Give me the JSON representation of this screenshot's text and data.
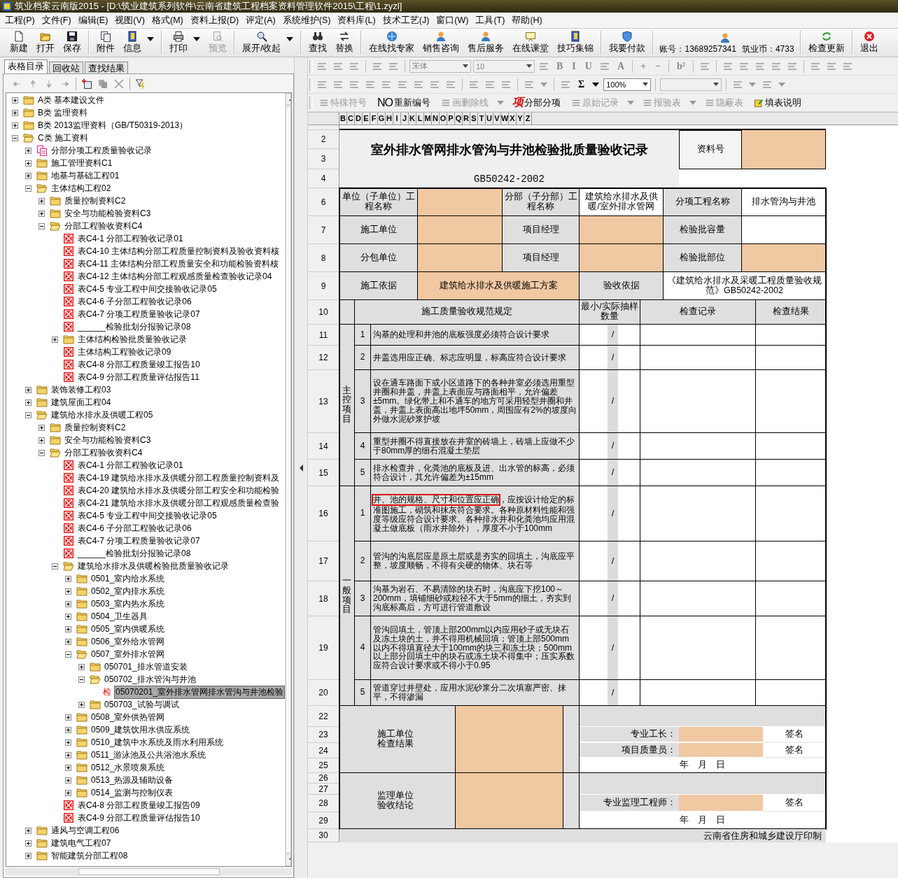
{
  "window": {
    "title": "筑业档案云南版2015 - [D:\\筑业建筑系列软件\\云南省建筑工程档案资料管理软件2015\\工程\\1.zyzl]"
  },
  "menu": [
    "工程(P)",
    "文件(F)",
    "编辑(E)",
    "视图(V)",
    "格式(M)",
    "资料上报(D)",
    "评定(A)",
    "系统维护(S)",
    "资料库(L)",
    "技术工艺(J)",
    "窗口(W)",
    "工具(T)",
    "帮助(H)"
  ],
  "toolbar": [
    {
      "kind": "button",
      "label": "新建",
      "disabled": false
    },
    {
      "kind": "button",
      "label": "打开",
      "disabled": false
    },
    {
      "kind": "button",
      "label": "保存",
      "disabled": false
    },
    {
      "kind": "separator"
    },
    {
      "kind": "button",
      "label": "附件",
      "disabled": false
    },
    {
      "kind": "button",
      "label": "信息",
      "disabled": false,
      "dropdown": true
    },
    {
      "kind": "separator"
    },
    {
      "kind": "button",
      "label": "打印",
      "disabled": false,
      "dropdown": true
    },
    {
      "kind": "button",
      "label": "预览",
      "disabled": true
    },
    {
      "kind": "separator"
    },
    {
      "kind": "button",
      "label": "展开/收起",
      "disabled": false,
      "dropdown": true
    },
    {
      "kind": "separator"
    },
    {
      "kind": "button",
      "label": "查找",
      "disabled": false
    },
    {
      "kind": "button",
      "label": "替换",
      "disabled": false
    },
    {
      "kind": "separator"
    },
    {
      "kind": "button",
      "label": "在线找专家",
      "disabled": false
    },
    {
      "kind": "button",
      "label": "销售咨询",
      "disabled": false
    },
    {
      "kind": "button",
      "label": "售后服务",
      "disabled": false
    },
    {
      "kind": "button",
      "label": "在线课堂",
      "disabled": false
    },
    {
      "kind": "button",
      "label": "技巧集锦",
      "disabled": false
    },
    {
      "kind": "separator"
    },
    {
      "kind": "button",
      "label": "我要付款",
      "disabled": false
    },
    {
      "kind": "separator"
    },
    {
      "kind": "account",
      "account": "账号：13689257341",
      "coins": "筑业币：4733"
    },
    {
      "kind": "separator"
    },
    {
      "kind": "button",
      "label": "检查更新",
      "disabled": false
    },
    {
      "kind": "separator"
    },
    {
      "kind": "button",
      "label": "退出",
      "disabled": false
    }
  ],
  "left_tabs": [
    {
      "label": "表格目录",
      "selected": true
    },
    {
      "label": "回收站",
      "selected": false
    },
    {
      "label": "查找结果",
      "selected": false
    }
  ],
  "tree": [
    {
      "label": "A类 基本建设文件",
      "kind": "folder",
      "expanded": false,
      "selected": false
    },
    {
      "label": "B类 监理资料",
      "kind": "folder",
      "expanded": false,
      "selected": false
    },
    {
      "label": "B类 2013监理资料（GB/T50319-2013）",
      "kind": "folder",
      "expanded": false,
      "selected": false
    },
    {
      "label": "C类 施工资料",
      "kind": "folder",
      "expanded": true,
      "selected": false,
      "children": [
        {
          "label": "分部分项工程质量验收记录",
          "kind": "doc",
          "expanded": false,
          "selected": false
        },
        {
          "label": "施工管理资料C1",
          "kind": "folder",
          "expanded": false,
          "selected": false
        },
        {
          "label": "地基与基础工程01",
          "kind": "folder",
          "expanded": false,
          "selected": false
        },
        {
          "label": "主体结构工程02",
          "kind": "folder",
          "expanded": true,
          "selected": false,
          "children": [
            {
              "label": "质量控制资料C2",
              "kind": "folder",
              "expanded": false,
              "selected": false
            },
            {
              "label": "安全与功能检验资料C3",
              "kind": "folder",
              "expanded": false,
              "selected": false
            },
            {
              "label": "分部工程验收资料C4",
              "kind": "folder",
              "expanded": true,
              "selected": false,
              "children": [
                {
                  "label": "表C4-1 分部工程验收记录01",
                  "kind": "form",
                  "selected": false
                },
                {
                  "label": "表C4-10 主体结构分部工程质量控制资料及验收资料核",
                  "kind": "form",
                  "selected": false
                },
                {
                  "label": "表C4-11 主体结构分部工程质量安全和功能检验资料核",
                  "kind": "form",
                  "selected": false
                },
                {
                  "label": "表C4-12 主体结构分部工程观感质量检查验收记录04",
                  "kind": "form",
                  "selected": false
                },
                {
                  "label": "表C4-5 专业工程中间交接验收记录05",
                  "kind": "form",
                  "selected": false
                },
                {
                  "label": "表C4-6 子分部工程验收记录06",
                  "kind": "form",
                  "selected": false
                },
                {
                  "label": "表C4-7 分项工程质量验收记录07",
                  "kind": "form",
                  "selected": false
                },
                {
                  "label": "______检验批划分报验记录08",
                  "kind": "form",
                  "selected": false
                },
                {
                  "label": "主体结构检验批质量验收记录",
                  "kind": "folder",
                  "expanded": false,
                  "selected": false
                },
                {
                  "label": "主体结构工程验收记录09",
                  "kind": "form",
                  "selected": false
                },
                {
                  "label": "表C4-8 分部工程质量竣工报告10",
                  "kind": "form",
                  "selected": false
                },
                {
                  "label": "表C4-9 分部工程质量评估报告11",
                  "kind": "form",
                  "selected": false
                }
              ]
            }
          ]
        },
        {
          "label": "装饰装修工程03",
          "kind": "folder",
          "expanded": false,
          "selected": false
        },
        {
          "label": "建筑屋面工程04",
          "kind": "folder",
          "expanded": false,
          "selected": false
        },
        {
          "label": "建筑给水排水及供暖工程05",
          "kind": "folder",
          "expanded": true,
          "selected": false,
          "children": [
            {
              "label": "质量控制资料C2",
              "kind": "folder",
              "expanded": false,
              "selected": false
            },
            {
              "label": "安全与功能检验资料C3",
              "kind": "folder",
              "expanded": false,
              "selected": false
            },
            {
              "label": "分部工程验收资料C4",
              "kind": "folder",
              "expanded": true,
              "selected": false,
              "children": [
                {
                  "label": "表C4-1 分部工程验收记录01",
                  "kind": "form",
                  "selected": false
                },
                {
                  "label": "表C4-19 建筑给水排水及供暖分部工程质量控制资料及",
                  "kind": "form",
                  "selected": false
                },
                {
                  "label": "表C4-20 建筑给水排水及供暖分部工程安全和功能检验",
                  "kind": "form",
                  "selected": false
                },
                {
                  "label": "表C4-21 建筑给水排水及供暖分部工程观感质量检查验",
                  "kind": "form",
                  "selected": false
                },
                {
                  "label": "表C4-5 专业工程中间交接验收记录05",
                  "kind": "form",
                  "selected": false
                },
                {
                  "label": "表C4-6 子分部工程验收记录06",
                  "kind": "form",
                  "selected": false
                },
                {
                  "label": "表C4-7 分项工程质量验收记录07",
                  "kind": "form",
                  "selected": false
                },
                {
                  "label": "______检验批划分报验记录08",
                  "kind": "form",
                  "selected": false
                },
                {
                  "label": "建筑给水排水及供暖检验批质量验收记录",
                  "kind": "folder",
                  "expanded": true,
                  "selected": false,
                  "children": [
                    {
                      "label": "0501_室内给水系统",
                      "kind": "folder",
                      "expanded": false,
                      "selected": false
                    },
                    {
                      "label": "0502_室内排水系统",
                      "kind": "folder",
                      "expanded": false,
                      "selected": false
                    },
                    {
                      "label": "0503_室内热水系统",
                      "kind": "folder",
                      "expanded": false,
                      "selected": false
                    },
                    {
                      "label": "0504_卫生器具",
                      "kind": "folder",
                      "expanded": false,
                      "selected": false
                    },
                    {
                      "label": "0505_室内供暖系统",
                      "kind": "folder",
                      "expanded": false,
                      "selected": false
                    },
                    {
                      "label": "0506_室外给水管网",
                      "kind": "folder",
                      "expanded": false,
                      "selected": false
                    },
                    {
                      "label": "0507_室外排水管网",
                      "kind": "folder",
                      "expanded": true,
                      "selected": false,
                      "children": [
                        {
                          "label": "050701_排水管道安装",
                          "kind": "folder",
                          "expanded": false,
                          "selected": false
                        },
                        {
                          "label": "050702_排水管沟与井池",
                          "kind": "folder",
                          "expanded": true,
                          "selected": false,
                          "children": [
                            {
                              "label": "05070201_室外排水管网排水管沟与井池检验",
                              "kind": "check",
                              "badge": "检",
                              "selected": true
                            }
                          ]
                        },
                        {
                          "label": "050703_试验与调试",
                          "kind": "folder",
                          "expanded": false,
                          "selected": false
                        }
                      ]
                    },
                    {
                      "label": "0508_室外供热管网",
                      "kind": "folder",
                      "expanded": false,
                      "selected": false
                    },
                    {
                      "label": "0509_建筑饮用水供应系统",
                      "kind": "folder",
                      "expanded": false,
                      "selected": false
                    },
                    {
                      "label": "0510_建筑中水系统及雨水利用系统",
                      "kind": "folder",
                      "expanded": false,
                      "selected": false
                    },
                    {
                      "label": "0511_游泳池及公共浴池水系统",
                      "kind": "folder",
                      "expanded": false,
                      "selected": false
                    },
                    {
                      "label": "0512_水景喷泉系统",
                      "kind": "folder",
                      "expanded": false,
                      "selected": false
                    },
                    {
                      "label": "0513_热源及辅助设备",
                      "kind": "folder",
                      "expanded": false,
                      "selected": false
                    },
                    {
                      "label": "0514_监测与控制仪表",
                      "kind": "folder",
                      "expanded": false,
                      "selected": false
                    }
                  ]
                },
                {
                  "label": "表C4-8 分部工程质量竣工报告09",
                  "kind": "form",
                  "selected": false
                },
                {
                  "label": "表C4-9 分部工程质量评估报告10",
                  "kind": "form",
                  "selected": false
                }
              ]
            }
          ]
        },
        {
          "label": "通风与空调工程06",
          "kind": "folder",
          "expanded": false,
          "selected": false
        },
        {
          "label": "建筑电气工程07",
          "kind": "folder",
          "expanded": false,
          "selected": false
        },
        {
          "label": "智能建筑分部工程08",
          "kind": "folder",
          "expanded": false,
          "selected": false
        }
      ]
    }
  ],
  "format_rows": [
    [
      {
        "kind": "icon",
        "disabled": true
      },
      {
        "kind": "icon",
        "disabled": true
      },
      {
        "kind": "icon",
        "disabled": true
      },
      {
        "kind": "separator"
      },
      {
        "kind": "icon",
        "disabled": true
      },
      {
        "kind": "icon",
        "disabled": true
      },
      {
        "kind": "separator"
      },
      {
        "kind": "combo",
        "value": "宋体",
        "disabled": true
      },
      {
        "kind": "combo",
        "value": "10",
        "disabled": true
      },
      {
        "kind": "icon",
        "disabled": true
      },
      {
        "kind": "glyph",
        "text": "B",
        "disabled": true
      },
      {
        "kind": "glyph",
        "text": "I",
        "disabled": true
      },
      {
        "kind": "glyph",
        "text": "U",
        "disabled": true
      },
      {
        "kind": "icon",
        "disabled": true
      },
      {
        "kind": "glyph",
        "text": "A",
        "disabled": true
      },
      {
        "kind": "separator"
      },
      {
        "kind": "glyph",
        "text": "+",
        "disabled": true
      },
      {
        "kind": "glyph",
        "text": "−",
        "disabled": true
      },
      {
        "kind": "separator"
      },
      {
        "kind": "glyph",
        "text": "b²",
        "disabled": true
      },
      {
        "kind": "separator"
      },
      {
        "kind": "icon",
        "disabled": true
      },
      {
        "kind": "separator"
      },
      {
        "kind": "icon",
        "disabled": true
      },
      {
        "kind": "icon",
        "disabled": true
      },
      {
        "kind": "icon",
        "disabled": true
      },
      {
        "kind": "icon",
        "disabled": true
      },
      {
        "kind": "icon",
        "disabled": true
      },
      {
        "kind": "separator"
      },
      {
        "kind": "icon",
        "disabled": true
      },
      {
        "kind": "icon",
        "disabled": true
      },
      {
        "kind": "icon",
        "disabled": true
      }
    ],
    [
      {
        "kind": "icon",
        "disabled": true
      },
      {
        "kind": "icon",
        "disabled": true
      },
      {
        "kind": "icon",
        "disabled": true
      },
      {
        "kind": "icon",
        "disabled": true
      },
      {
        "kind": "icon",
        "disabled": true
      },
      {
        "kind": "icon",
        "disabled": true
      },
      {
        "kind": "icon",
        "disabled": true
      },
      {
        "kind": "icon",
        "disabled": true
      },
      {
        "kind": "icon",
        "disabled": true
      },
      {
        "kind": "separator"
      },
      {
        "kind": "icon",
        "disabled": true
      },
      {
        "kind": "icon",
        "disabled": true
      },
      {
        "kind": "icon",
        "disabled": true
      },
      {
        "kind": "separator"
      },
      {
        "kind": "icon",
        "disabled": true
      },
      {
        "kind": "drop",
        "disabled": true
      },
      {
        "kind": "separator"
      },
      {
        "kind": "icon",
        "disabled": true
      },
      {
        "kind": "glyph",
        "text": "Σ",
        "disabled": false
      },
      {
        "kind": "drop",
        "disabled": false
      },
      {
        "kind": "combo",
        "value": "100%",
        "disabled": false
      },
      {
        "kind": "separator"
      },
      {
        "kind": "combo",
        "disabled": true
      },
      {
        "kind": "separator"
      },
      {
        "kind": "icon",
        "disabled": true
      },
      {
        "kind": "drop",
        "disabled": true
      },
      {
        "kind": "icon",
        "disabled": true
      },
      {
        "kind": "drop",
        "disabled": true
      }
    ]
  ],
  "form_toolbar": [
    {
      "label": "特殊符号",
      "disabled": true
    },
    {
      "glyph": "NO",
      "label": "重新编号",
      "disabled": false
    },
    {
      "label": "画删除线",
      "disabled": true,
      "dropdown": true
    },
    {
      "glyph": "项",
      "label": "分部分项",
      "disabled": false
    },
    {
      "label": "原始记录",
      "disabled": true,
      "dropdown": true
    },
    {
      "label": "报验表",
      "disabled": true,
      "dropdown": true
    },
    {
      "label": "隐蔽表",
      "disabled": true
    },
    {
      "label": "填表说明",
      "disabled": false
    }
  ],
  "column_headers": [
    "B",
    "C",
    "D",
    "E",
    "F",
    "G",
    "H",
    "I",
    "J",
    "K",
    "L",
    "M",
    "N",
    "O",
    "P",
    "Q",
    "R",
    "S",
    "T",
    "U",
    "V",
    "W",
    "X",
    "Y",
    "Z"
  ],
  "row_numbers": [
    "2",
    "3",
    "4",
    "6",
    "7",
    "8",
    "9",
    "10",
    "11",
    "12",
    "13",
    "14",
    "15",
    "16",
    "17",
    "18",
    "19",
    "20",
    "22",
    "23",
    "24",
    "25",
    "26",
    "27",
    "28",
    "29",
    "30"
  ],
  "form": {
    "title": "室外排水管网排水管沟与井池检验批质量验收记录",
    "doc_no_label": "资料号",
    "standard": "GB50242-2002",
    "info_rows": [
      {
        "kind": "triple",
        "cells": [
          {
            "label": "单位（子单位）工程名称",
            "field": true
          },
          {
            "label": "分部（子分部）工程名称",
            "value": "建筑给水排水及供暖/室外排水管网",
            "field": false
          },
          {
            "label": "分项工程名称",
            "value": "排水管沟与井池",
            "field": false
          }
        ]
      },
      {
        "kind": "triple",
        "cells": [
          {
            "label": "施工单位",
            "field": true
          },
          {
            "label": "项目经理",
            "field": true
          },
          {
            "label": "检验批容量",
            "field": false
          }
        ]
      },
      {
        "kind": "triple",
        "cells": [
          {
            "label": "分包单位",
            "field": true
          },
          {
            "label": "项目经理",
            "field": true
          },
          {
            "label": "检验批部位",
            "field": true
          }
        ]
      },
      {
        "kind": "pair",
        "cells": [
          {
            "label": "施工依据",
            "value": "建筑给水排水及供暖施工方案",
            "field": true
          },
          {
            "label": "验收依据",
            "value": "《建筑给水排水及采暖工程质量验收规范》GB50242-2002",
            "field": false
          }
        ]
      }
    ],
    "spec_headers": [
      "施工质量验收规范规定",
      "最小/实际抽样数量",
      "检查记录",
      "检查结果"
    ],
    "groups": [
      {
        "name": "主控项目",
        "items": [
          {
            "no": "1",
            "text": "沟基的处理和井池的底板强度必须符合设计要求",
            "sample": "/"
          },
          {
            "no": "2",
            "text": "井盖选用应正确、标志应明显，标高应符合设计要求",
            "sample": "/"
          },
          {
            "no": "3",
            "text": "设在通车路面下或小区道路下的各种井室必须选用重型井圈和井盖，井盖上表面应与路面相平，允许偏差±5mm。绿化带上和不通车的地方可采用轻型井圈和井盖，井盖上表面高出地坪50mm，周围应有2%的坡度向外做水泥砂浆护坡",
            "sample": "/"
          },
          {
            "no": "4",
            "text": "重型井圈不得直接放在井室的砖墙上，砖墙上应做不少于80mm厚的细石混凝土垫层",
            "sample": "/"
          },
          {
            "no": "5",
            "text": "排水检查井，化粪池的底板及进、出水管的标高，必须符合设计，其允许偏差为±15mm",
            "sample": "/"
          }
        ]
      },
      {
        "name": "一般项目",
        "items": [
          {
            "no": "1",
            "parts": [
              {
                "text": "井、池的规格、尺寸和位置应正确",
                "marked": true
              },
              {
                "text": "，应按设计给定的标准图施工，砌筑和抹灰符合要求。各种原材料性能和强度等级应符合设计要求。各种排水井和化粪池均应用混凝土做底板（雨水井除外），厚度不小于100mm",
                "marked": false
              }
            ],
            "sample": "/"
          },
          {
            "no": "2",
            "text": "管沟的沟底层应是原土层或是夯实的回填土，沟底应平整，坡度顺畅，不得有尖硬的物体、块石等",
            "sample": "/"
          },
          {
            "no": "3",
            "text": "沟基为岩石、不易清除的块石时，沟底应下挖100～200mm，填铺细砂或粒径不大于5mm的细土，夯实到沟底标高后，方可进行管道敷设",
            "sample": "/"
          },
          {
            "no": "4",
            "text": "管沟回填土，管顶上部200mm以内应用砂子或无块石及冻土块的土，并不得用机械回填；管顶上部500mm以内不得填直径大于100mm的块三和冻土块；500mm以上部分回填土中的块石或冻土块不得集中；压实系数应符合设计要求或不得小于0.95",
            "sample": "/"
          },
          {
            "no": "5",
            "text": "管道穿过井壁处，应用水泥砂浆分二次填塞严密、抹平，不得渗漏",
            "sample": "/"
          }
        ]
      }
    ],
    "sections": [
      {
        "label": "施工单位检查结果",
        "signers": [
          {
            "role": "专业工长：",
            "sign": "签名"
          },
          {
            "role": "项目质量员：",
            "sign": "签名"
          }
        ],
        "date": "年　月　日"
      },
      {
        "label": "监理单位验收结论",
        "signers": [
          {
            "role": "专业监理工程师：",
            "sign": "签名"
          }
        ],
        "date": "年　月　日"
      }
    ],
    "footer": "云南省住房和城乡建设厅印制"
  }
}
